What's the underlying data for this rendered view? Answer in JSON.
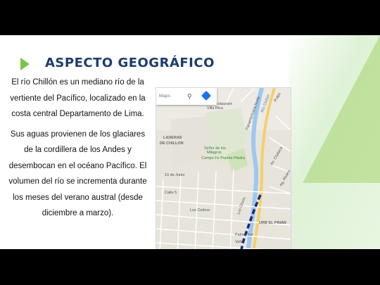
{
  "slide": {
    "title": "ASPECTO GEOGRÁFICO",
    "paragraphs": [
      "El río Chillón es un mediano río de la vertiente del Pacífico, localizado en la costa central Departamento de Lima.",
      "Sus aguas provienen de los glaciares de la cordillera de los Andes y desembocan en el océano Pacífico. El volumen del río se incrementa durante los meses del verano austral (desde diciembre a marzo)."
    ]
  },
  "map": {
    "search_label": "Maps",
    "search_icon": "search-icon",
    "directions_icon": "directions-icon",
    "colors": {
      "river": "#9dc8ef",
      "route": "#1b2a7a",
      "park": "#cfe3b8",
      "road": "#f6cf6a"
    },
    "labels": {
      "laderas": "LADERAS",
      "de_chillon": "DE CHILLON",
      "senor": "Señor de los",
      "milagros": "Milagros",
      "campo": "Campo Fe Puente Piedra",
      "urb": "URB EL PINAR",
      "club": "Club Restaurant",
      "villa": "Villa Rica",
      "panamericana": "Panamericana Norte",
      "rio": "Rio Chillon",
      "calle5": "Calle 5",
      "junio": "10 de Junio",
      "palma": "Palma Sur",
      "valle": "Valle",
      "chalaca": "Av. Chalaca",
      "av_rivera": "Ag. Rivera",
      "pulpo": "Pulpo",
      "los_olivos": "Los Olivos",
      "los_cedros": "Los Cedros"
    }
  }
}
